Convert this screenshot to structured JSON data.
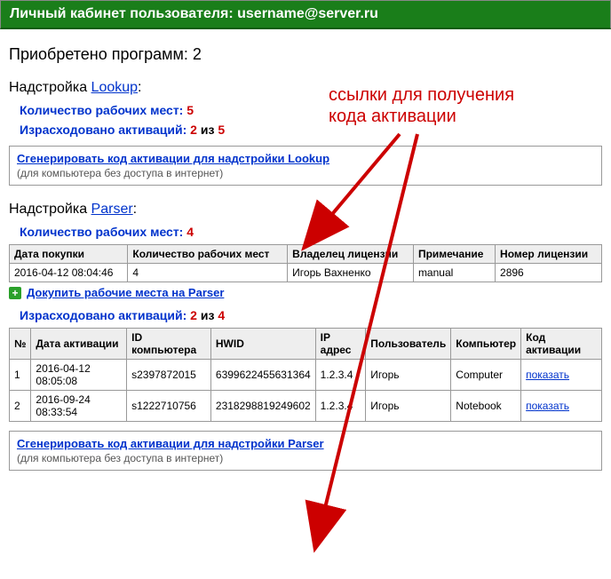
{
  "header": {
    "title_prefix": "Личный кабинет пользователя: ",
    "username": "username@server.ru"
  },
  "summary": {
    "label": "Приобретено программ: ",
    "count": "2"
  },
  "annotation": {
    "line1": "ссылки для получения",
    "line2": "кода активации"
  },
  "lookup": {
    "title_prefix": "Надстройка ",
    "title_link": "Lookup",
    "title_suffix": ":",
    "seats_label": "Количество рабочих мест: ",
    "seats_value": "5",
    "used_label": "Израсходовано активаций: ",
    "used_value": "2",
    "used_sep": " из ",
    "used_total": "5",
    "gen_link": "Сгенерировать код активации для надстройки Lookup",
    "gen_sub": "(для компьютера без доступа в интернет)"
  },
  "parser": {
    "title_prefix": "Надстройка ",
    "title_link": "Parser",
    "title_suffix": ":",
    "seats_label": "Количество рабочих мест: ",
    "seats_value": "4",
    "purchase_headers": {
      "date": "Дата покупки",
      "seats": "Количество рабочих мест",
      "owner": "Владелец лицензии",
      "note": "Примечание",
      "lic": "Номер лицензии"
    },
    "purchase_row": {
      "date": "2016-04-12 08:04:46",
      "seats": "4",
      "owner": "Игорь Вахненко",
      "note": "manual",
      "lic": "2896"
    },
    "add_link": "Докупить рабочие места на Parser",
    "used_label": "Израсходовано активаций: ",
    "used_value": "2",
    "used_sep": " из ",
    "used_total": "4",
    "act_headers": {
      "n": "№",
      "date": "Дата активации",
      "id": "ID компьютера",
      "hwid": "HWID",
      "ip": "IP адрес",
      "user": "Пользователь",
      "comp": "Компьютер",
      "code": "Код активации"
    },
    "act_rows": [
      {
        "n": "1",
        "date": "2016-04-12 08:05:08",
        "id": "s2397872015",
        "hwid": "6399622455631364",
        "ip": "1.2.3.4",
        "user": "Игорь",
        "comp": "Computer",
        "code": "показать"
      },
      {
        "n": "2",
        "date": "2016-09-24 08:33:54",
        "id": "s1222710756",
        "hwid": "2318298819249602",
        "ip": "1.2.3.4",
        "user": "Игорь",
        "comp": "Notebook",
        "code": "показать"
      }
    ],
    "gen_link": "Сгенерировать код активации для надстройки Parser",
    "gen_sub": "(для компьютера без доступа в интернет)"
  }
}
